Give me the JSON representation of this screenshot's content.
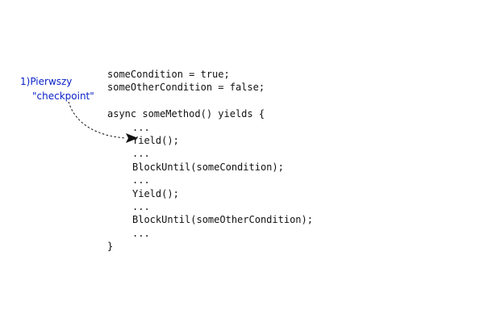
{
  "annotation": {
    "line1": "1)Pierwszy",
    "line2": "\"checkpoint\"",
    "color": "#0b22c8"
  },
  "code": {
    "line1": "someCondition = true;",
    "line2": "someOtherCondition = false;",
    "line3": "",
    "line4": "async someMethod() yields {",
    "line5": "...",
    "line6": "Yield();",
    "line7": "...",
    "line8": "BlockUntil(someCondition);",
    "line9": "...",
    "line10": "Yield();",
    "line11": "...",
    "line12": "BlockUntil(someOtherCondition);",
    "line13": "...",
    "line14": "}"
  }
}
